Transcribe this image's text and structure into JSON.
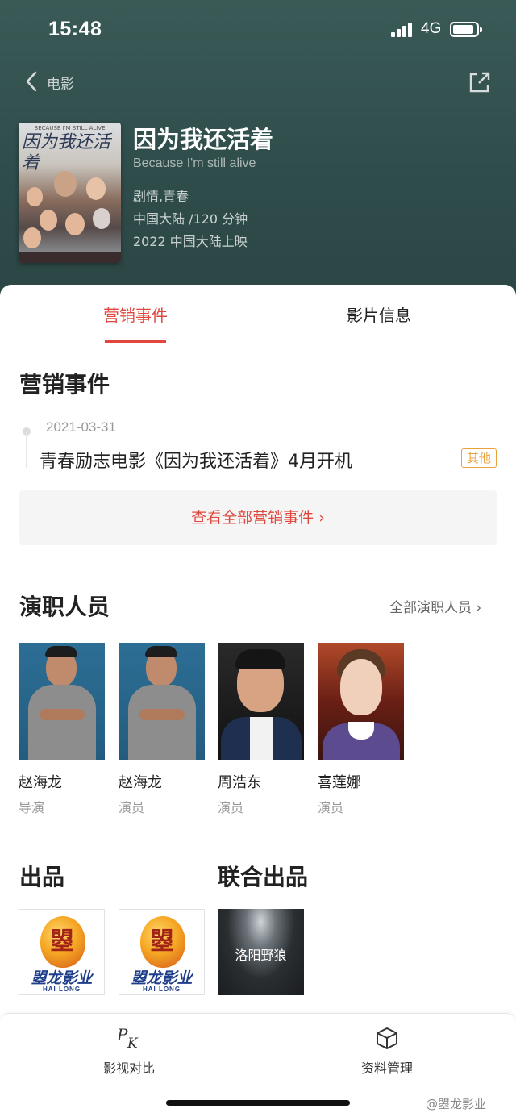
{
  "status_bar": {
    "time": "15:48",
    "network": "4G",
    "battery_percent": 90
  },
  "nav": {
    "back_label": "电影"
  },
  "movie": {
    "poster_subtitle": "BECAUSE I'M STILL ALIVE",
    "poster_title": "因为我还活着",
    "title": "因为我还活着",
    "english_title": "Because I'm still alive",
    "genre": "剧情,青春",
    "region_duration": "中国大陆 /120 分钟",
    "release": "2022 中国大陆上映"
  },
  "tabs": [
    {
      "label": "营销事件",
      "active": true
    },
    {
      "label": "影片信息",
      "active": false
    }
  ],
  "marketing": {
    "section_title": "营销事件",
    "events": [
      {
        "date": "2021-03-31",
        "text": "青春励志电影《因为我还活着》4月开机",
        "tag": "其他"
      }
    ],
    "view_all_label": "查看全部营销事件 ›"
  },
  "cast": {
    "section_title": "演职人员",
    "more_label": "全部演职人员 ›",
    "members": [
      {
        "name": "赵海龙",
        "role": "导演"
      },
      {
        "name": "赵海龙",
        "role": "演员"
      },
      {
        "name": "周浩东",
        "role": "演员"
      },
      {
        "name": "喜莲娜",
        "role": "演员"
      }
    ]
  },
  "production": {
    "section_title": "出品",
    "companies": [
      {
        "name_cn": "曌龙影业",
        "name_en": "HAI LONG"
      },
      {
        "name_cn": "曌龙影业",
        "name_en": "HAI LONG"
      }
    ]
  },
  "co_production": {
    "section_title": "联合出品",
    "companies": [
      {
        "name": "洛阳野狼"
      }
    ]
  },
  "bottom_bar": {
    "items": [
      {
        "label": "影视对比",
        "icon": "pk-icon"
      },
      {
        "label": "资料管理",
        "icon": "box-icon"
      }
    ]
  },
  "watermark": "@曌龙影业",
  "colors": {
    "accent": "#e0483e",
    "tag": "#e9a23b",
    "header": "#2f4d4b"
  }
}
